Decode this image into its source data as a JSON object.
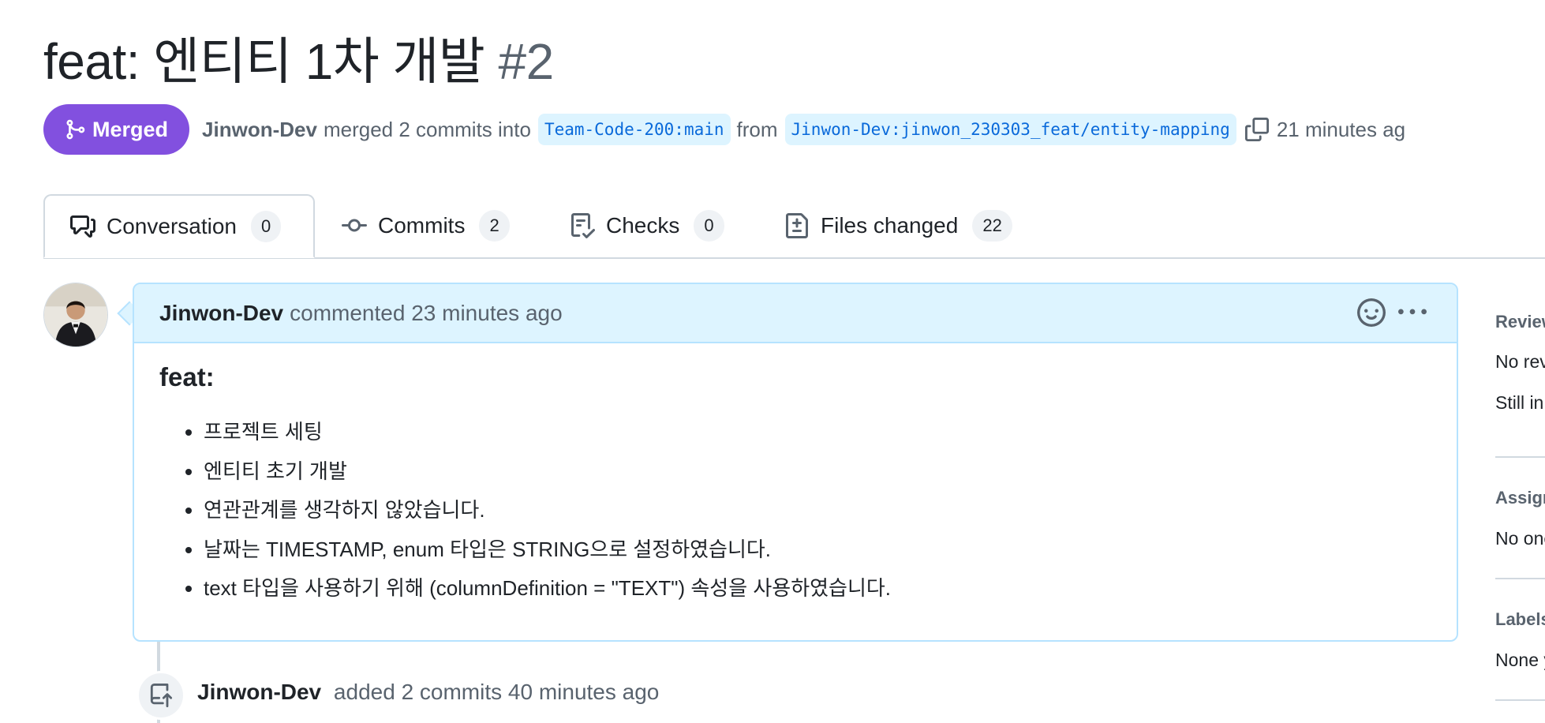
{
  "pr": {
    "title": "feat: 엔티티 1차 개발",
    "number": "#2"
  },
  "meta": {
    "status": "Merged",
    "author": "Jinwon-Dev",
    "merged_text": "merged 2 commits into",
    "base_branch": "Team-Code-200:main",
    "from_text": "from",
    "head_branch": "Jinwon-Dev:jinwon_230303_feat/entity-mapping",
    "time": "21 minutes ag"
  },
  "tabs": [
    {
      "label": "Conversation",
      "count": "0"
    },
    {
      "label": "Commits",
      "count": "2"
    },
    {
      "label": "Checks",
      "count": "0"
    },
    {
      "label": "Files changed",
      "count": "22"
    }
  ],
  "comment": {
    "author": "Jinwon-Dev",
    "action": "commented 23 minutes ago",
    "heading": "feat:",
    "items": [
      "프로젝트 세팅",
      "엔티티 초기 개발",
      "연관관계를 생각하지 않았습니다.",
      "날짜는 TIMESTAMP, enum 타입은 STRING으로 설정하였습니다.",
      "text 타입을 사용하기 위해 (columnDefinition = \"TEXT\") 속성을 사용하였습니다."
    ]
  },
  "timeline": {
    "author": "Jinwon-Dev",
    "text": "added 2 commits 40 minutes ago"
  },
  "sidebar": {
    "reviewers_heading": "Reviewers",
    "reviewers_line1": "No reviews",
    "reviewers_line2": "Still in progress?",
    "assignees_heading": "Assignees",
    "assignees_text": "No one assigned",
    "labels_heading": "Labels",
    "labels_text": "None yet"
  },
  "colors": {
    "merged": "#8250df",
    "accent": "#0969da",
    "comment_header": "#ddf4ff",
    "border": "#d1d9e0"
  }
}
